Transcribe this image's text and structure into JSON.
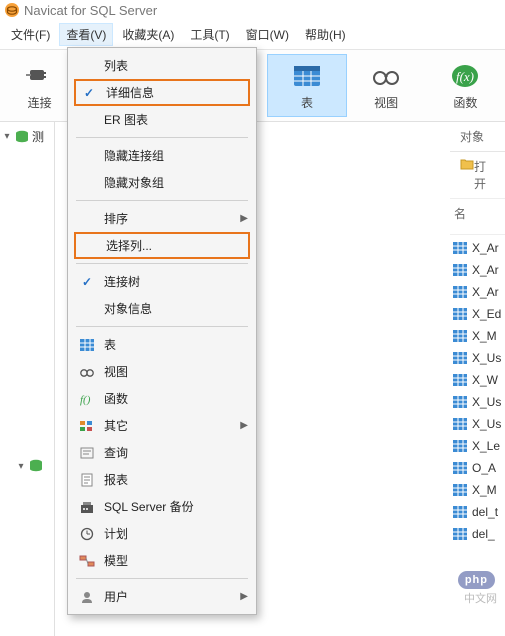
{
  "title": "Navicat for SQL Server",
  "menubar": {
    "file": "文件(F)",
    "view": "查看(V)",
    "favorites": "收藏夹(A)",
    "tools": "工具(T)",
    "window": "窗口(W)",
    "help": "帮助(H)"
  },
  "toolbar": {
    "connect": "连接",
    "table": "表",
    "view": "视图",
    "function": "函数"
  },
  "dropdown": {
    "list": "列表",
    "details": "详细信息",
    "erdiagram": "ER 图表",
    "hideConnGroup": "隐藏连接组",
    "hideObjGroup": "隐藏对象组",
    "sort": "排序",
    "chooseColumns": "选择列...",
    "connTree": "连接树",
    "objInfo": "对象信息",
    "table": "表",
    "view": "视图",
    "function": "函数",
    "other": "其它",
    "query": "查询",
    "report": "报表",
    "backup": "SQL Server 备份",
    "schedule": "计划",
    "model": "模型",
    "user": "用户"
  },
  "tree": {
    "node": "测"
  },
  "right": {
    "objects": "对象",
    "open": "打开",
    "nameHeader": "名"
  },
  "tables": [
    "X_Ar",
    "X_Ar",
    "X_Ar",
    "X_Ed",
    "X_M",
    "X_Us",
    "X_W",
    "X_Us",
    "X_Us",
    "X_Le",
    "O_A",
    "X_M",
    "del_t",
    "del_"
  ],
  "watermark": "中文网",
  "phpBadge": "php"
}
